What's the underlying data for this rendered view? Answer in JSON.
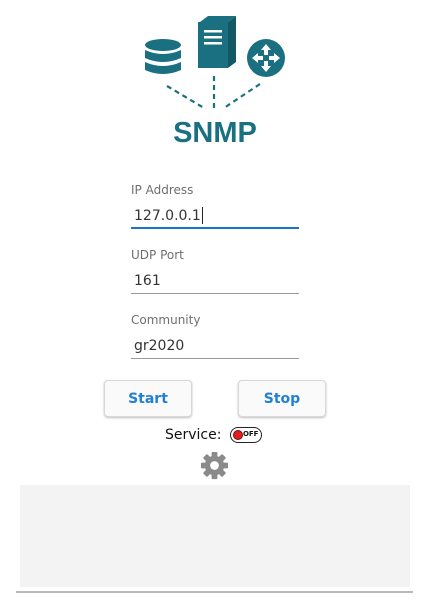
{
  "logo": {
    "text": "SNMP",
    "color": "#1a7080",
    "icons": [
      "database-icon",
      "server-icon",
      "router-icon"
    ]
  },
  "form": {
    "ip": {
      "label": "IP Address",
      "value": "127.0.0.1"
    },
    "port": {
      "label": "UDP Port",
      "value": "161"
    },
    "community": {
      "label": "Community",
      "value": "gr2020"
    }
  },
  "buttons": {
    "start": "Start",
    "stop": "Stop"
  },
  "service": {
    "label": "Service:",
    "toggle_text": "OFF",
    "state_color": "#e0201b"
  },
  "settings_icon": "gear-icon",
  "accent_color": "#2180d6"
}
